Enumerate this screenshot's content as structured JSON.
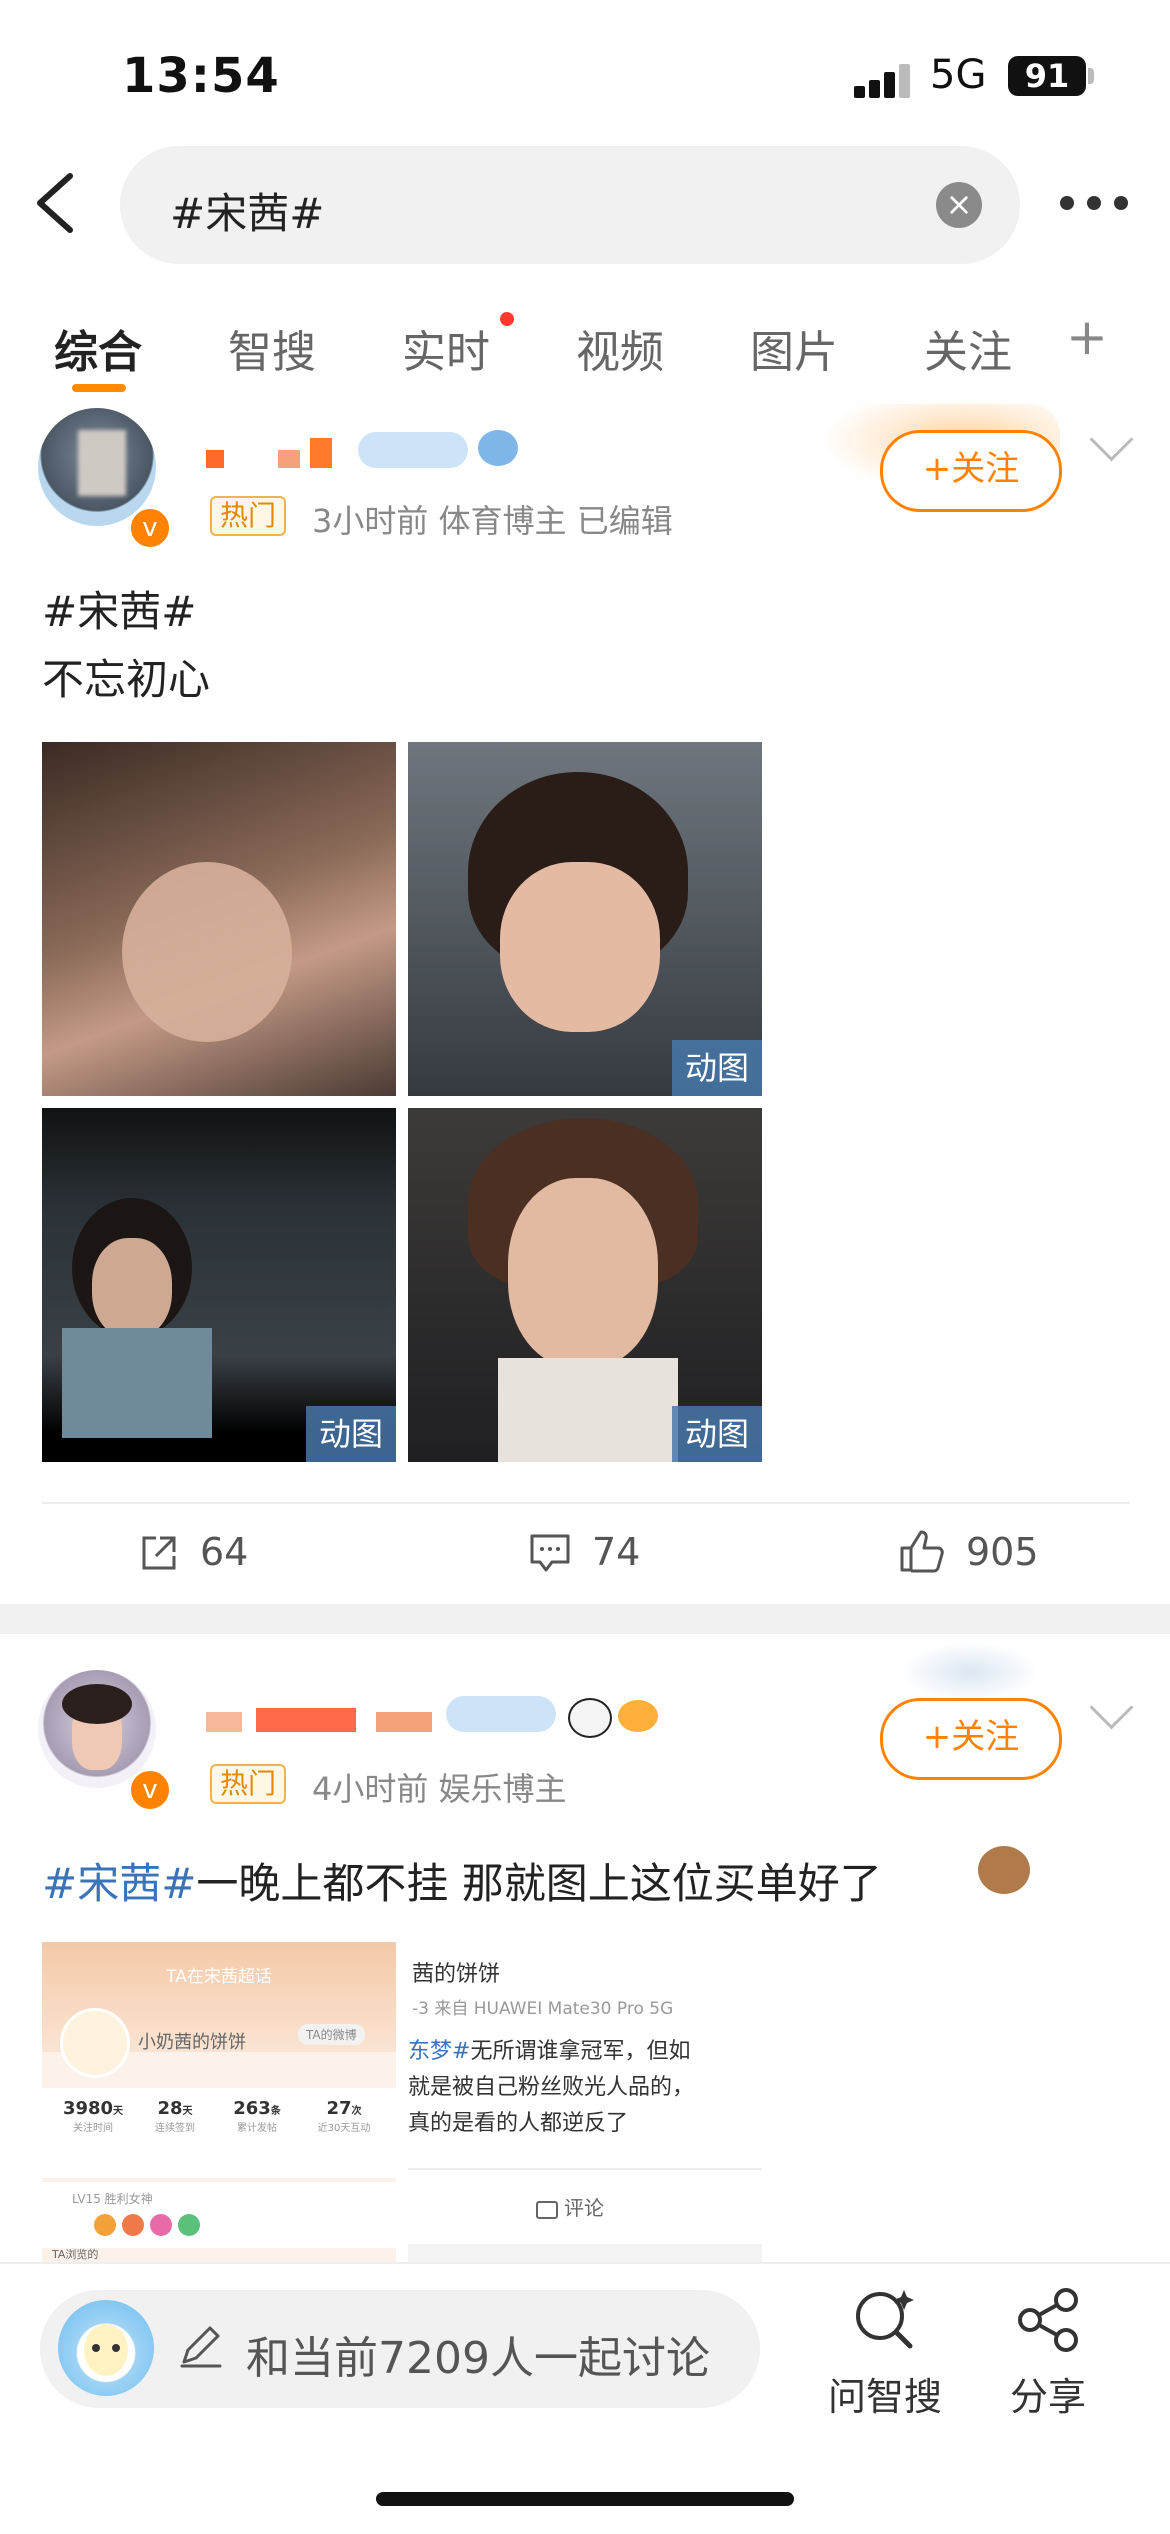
{
  "status": {
    "time": "13:54",
    "network": "5G",
    "battery": "91"
  },
  "search": {
    "query": "#宋茜#"
  },
  "tabs": [
    "综合",
    "智搜",
    "实时",
    "视频",
    "图片",
    "关注"
  ],
  "tab_plus": "+",
  "post1": {
    "hot": "热门",
    "meta": "3小时前  体育博主  已编辑",
    "follow": "+关注",
    "topic": "#宋茜#",
    "text": "不忘初心",
    "gif_label": "动图",
    "reposts": "64",
    "comments": "74",
    "likes": "905"
  },
  "post2": {
    "hot": "热门",
    "meta": "4小时前  娱乐博主",
    "follow": "+关注",
    "topic": "#宋茜#",
    "text": "一晚上都不挂 那就图上这位买单好了",
    "screenshot_left": {
      "title": "TA在宋茜超话",
      "name": "小奶茜的饼饼",
      "tag": "TA的微博",
      "stats": [
        {
          "num": "3980",
          "unit": "天",
          "label": "关注时间"
        },
        {
          "num": "28",
          "unit": "天",
          "label": "连续签到"
        },
        {
          "num": "263",
          "unit": "条",
          "label": "累计发帖"
        },
        {
          "num": "27",
          "unit": "次",
          "label": "近30天互动"
        }
      ],
      "level": "LV15 胜利女神",
      "footer": "TA浏览的"
    },
    "screenshot_right": {
      "name": "茜的饼饼",
      "source": "-3  来自 HUAWEI Mate30 Pro 5G",
      "line1_topic": "东梦#",
      "line1": "无所谓谁拿冠军，但如",
      "line2": "就是被自己粉丝败光人品的，",
      "line3": "真的是看的人都逆反了",
      "comment": "评论"
    }
  },
  "bottom": {
    "discuss": "和当前7209人一起讨论",
    "ask": "问智搜",
    "share": "分享"
  },
  "colors": {
    "accent": "#ff8200",
    "topic": "#3b73b9",
    "hot_bg": "#fff7e8"
  }
}
